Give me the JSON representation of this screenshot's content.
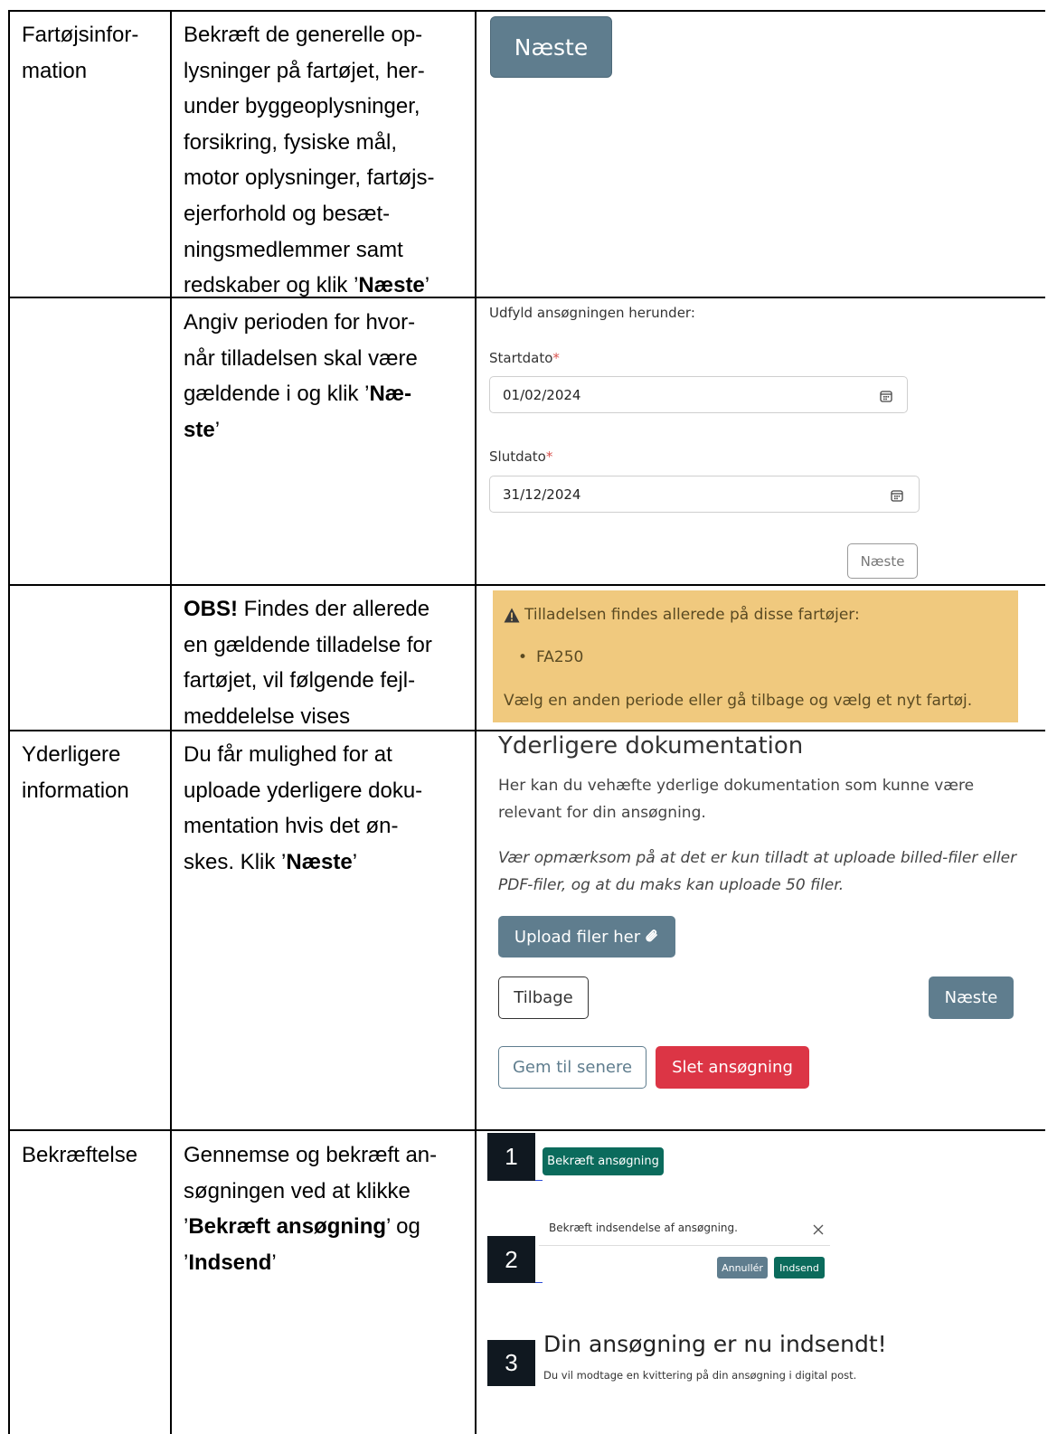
{
  "rows": {
    "fartoej": {
      "label": "Fartøjsinfor-\nmation",
      "lines": [
        "Bekræft de generelle op-",
        "lysninger på fartøjet, her-",
        "under byggeoplysninger,",
        "forsikring, fysiske mål,",
        "motor oplysninger, fartøjs-",
        "ejerforhold og besæt-",
        "ningsmedlemmer samt"
      ],
      "last_pre": "redskaber og klik ’",
      "last_bold": "Næste",
      "last_post": "’",
      "button": "Næste"
    },
    "periode": {
      "lines": [
        "Angiv perioden for hvor-",
        "når tilladelsen skal være"
      ],
      "line3_pre": "gældende i og klik ’",
      "line3_bold": "Næ-",
      "line4_bold": "ste",
      "line4_post": "’",
      "form_intro": "Udfyld ansøgningen herunder:",
      "start_label": "Startdato",
      "start_value": "01/02/2024",
      "end_label": "Slutdato",
      "end_value": "31/12/2024",
      "required_mark": "*",
      "next_button": "Næste"
    },
    "obs": {
      "bold": "OBS!",
      "line1_post": " Findes der allerede",
      "lines": [
        "en gældende tilladelse for",
        "fartøjet, vil følgende fejl-",
        "meddelelse vises"
      ],
      "warning_title": "Tilladelsen findes allerede på disse fartøjer:",
      "warning_item": "FA250",
      "warning_footer": "Vælg en anden periode eller gå tilbage og vælg et nyt fartøj."
    },
    "dokumentation": {
      "label": "Yderligere\ninformation",
      "lines": [
        "Du får mulighed for at",
        "uploade yderligere doku-",
        "mentation hvis det øn-"
      ],
      "last_pre": "skes. Klik ’",
      "last_bold": "Næste",
      "last_post": "’",
      "heading": "Yderligere dokumentation",
      "desc": "Her kan du vehæfte yderlige dokumentation som kunne være relevant for din ansøgning.",
      "note": "Vær opmærksom på at det er kun tilladt at uploade billed-filer eller PDF-filer, og at du maks kan uploade 50 filer.",
      "upload_button": "Upload filer her",
      "back_button": "Tilbage",
      "next_button": "Næste",
      "save_button": "Gem til senere",
      "delete_button": "Slet ansøgning"
    },
    "bekraeftelse": {
      "label": "Bekræftelse",
      "line1": "Gennemse og bekræft an-",
      "line2": "søgningen ved at klikke",
      "line3_pre": "’",
      "line3_bold": "Bekræft ansøgning",
      "line3_post": "’ og",
      "line4_pre": "’",
      "line4_bold": "Indsend",
      "line4_post": "’",
      "step1": "1",
      "step2": "2",
      "step3": "3",
      "confirm_button": "Bekræft ansøgning",
      "dialog_text": "Bekræft indsendelse af ansøgning.",
      "cancel_button": "Annullér",
      "submit_button": "Indsend",
      "success_title": "Din ansøgning er nu indsendt!",
      "success_text": "Du vil modtage en kvittering på din ansøgning i digital post."
    }
  },
  "colors": {
    "button_grey": "#5f7d8e",
    "button_teal": "#0b6b5c",
    "danger_red": "#dc3545",
    "warning_bg": "#f0c97e",
    "badge_dark": "#101820"
  },
  "icons": [
    "calendar-icon",
    "warning-triangle-icon",
    "paperclip-icon",
    "close-icon"
  ]
}
